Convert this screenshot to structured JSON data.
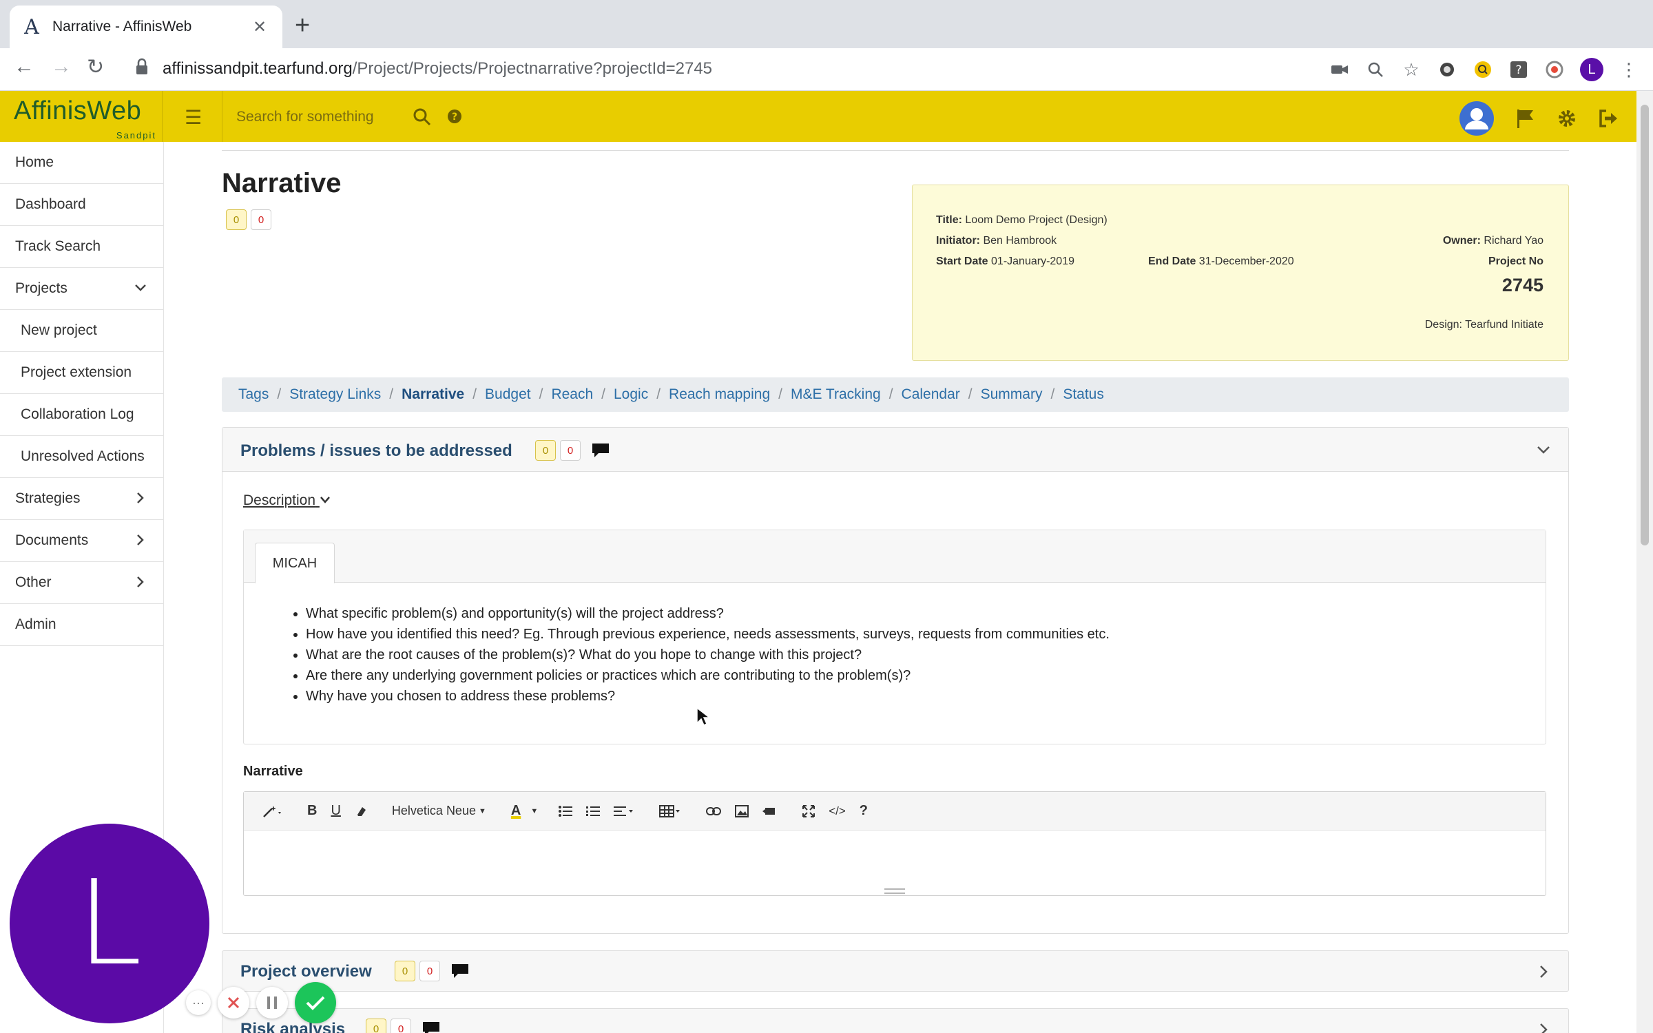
{
  "browser": {
    "tab_title": "Narrative - AffinisWeb",
    "tab_favicon": "A",
    "url_host": "affinissandpit.tearfund.org",
    "url_path": "/Project/Projects/Projectnarrative?projectId=2745",
    "profile_initial": "L"
  },
  "header": {
    "logo": "AffinisWeb",
    "logo_sub": "Sandpit",
    "search_placeholder": "Search for something",
    "accent_color": "#e8cd00"
  },
  "sidebar": {
    "items": [
      {
        "label": "Home"
      },
      {
        "label": "Dashboard"
      },
      {
        "label": "Track Search"
      },
      {
        "label": "Projects"
      },
      {
        "label": "New project"
      },
      {
        "label": "Project extension"
      },
      {
        "label": "Collaboration Log"
      },
      {
        "label": "Unresolved Actions"
      },
      {
        "label": "Strategies"
      },
      {
        "label": "Documents"
      },
      {
        "label": "Other"
      },
      {
        "label": "Admin"
      }
    ]
  },
  "page": {
    "title": "Narrative",
    "badge_yellow": "0",
    "badge_red": "0"
  },
  "info": {
    "title_label": "Title:",
    "title_value": "Loom Demo Project (Design)",
    "initiator_label": "Initiator:",
    "initiator_value": "Ben Hambrook",
    "start_label": "Start Date",
    "start_value": "01-January-2019",
    "end_label": "End Date",
    "end_value": "31-December-2020",
    "owner_label": "Owner:",
    "owner_value": "Richard Yao",
    "project_no_label": "Project No",
    "project_no": "2745",
    "design": "Design: Tearfund Initiate"
  },
  "breadcrumbs": [
    {
      "label": "Tags"
    },
    {
      "label": "Strategy Links"
    },
    {
      "label": "Narrative"
    },
    {
      "label": "Budget"
    },
    {
      "label": "Reach"
    },
    {
      "label": "Logic"
    },
    {
      "label": "Reach mapping"
    },
    {
      "label": "M&E Tracking"
    },
    {
      "label": "Calendar"
    },
    {
      "label": "Summary"
    },
    {
      "label": "Status"
    }
  ],
  "crumb_sep": "/",
  "problems": {
    "title": "Problems / issues to be addressed",
    "badge_yellow": "0",
    "badge_red": "0",
    "description_toggle": "Description",
    "micah_tab": "MICAH",
    "bullets": [
      "What specific problem(s) and opportunity(s) will the project address?",
      "How have you identified this need? Eg. Through previous experience, needs assessments, surveys, requests from communities etc.",
      "What are the root causes of the problem(s)? What do you hope to change with this project?",
      "Are there any underlying government policies or practices which are contributing to the problem(s)?",
      "Why have you chosen to address these problems?"
    ],
    "narrative_label": "Narrative",
    "editor_font": "Helvetica Neue"
  },
  "overview": {
    "title": "Project overview",
    "badge_yellow": "0",
    "badge_red": "0"
  },
  "risk": {
    "title": "Risk analysis",
    "badge_yellow": "0",
    "badge_red": "0"
  },
  "recorder": {
    "initial": "L"
  }
}
